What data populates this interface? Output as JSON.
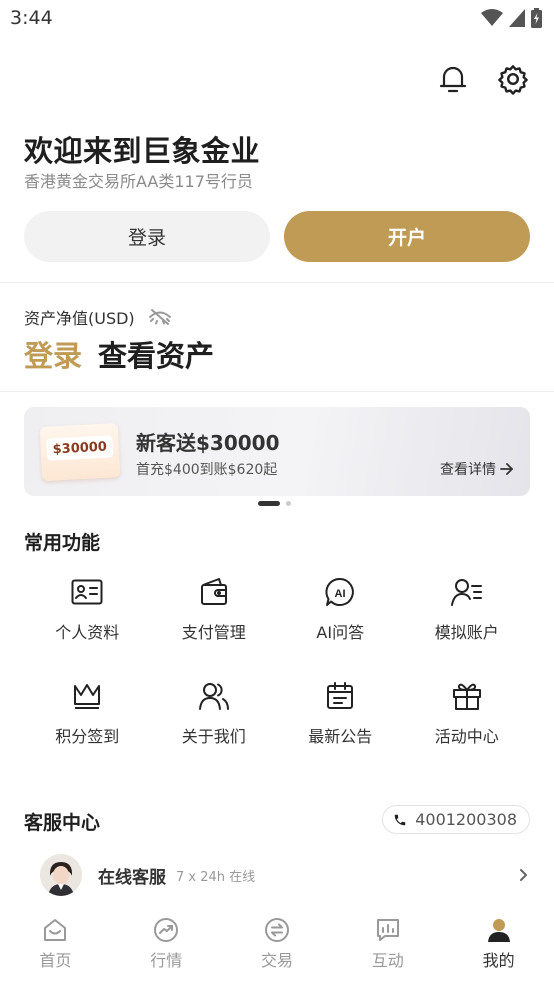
{
  "status_bar": {
    "time": "3:44"
  },
  "header": {
    "title": "欢迎来到巨象金业",
    "subtitle": "香港黄金交易所AA类117号行员",
    "login_button": "登录",
    "open_account_button": "开户"
  },
  "assets": {
    "label": "资产净值(USD)",
    "login_text": "登录",
    "view_text": "查看资产"
  },
  "banner": {
    "ticket_amount": "$30000",
    "title": "新客送$30000",
    "subtitle": "首充$400到账$620起",
    "link": "查看详情"
  },
  "functions": {
    "title": "常用功能",
    "items": [
      {
        "label": "个人资料",
        "icon": "id-card-icon"
      },
      {
        "label": "支付管理",
        "icon": "wallet-icon"
      },
      {
        "label": "AI问答",
        "icon": "ai-chat-icon"
      },
      {
        "label": "模拟账户",
        "icon": "user-list-icon"
      },
      {
        "label": "积分签到",
        "icon": "crown-icon"
      },
      {
        "label": "关于我们",
        "icon": "users-icon"
      },
      {
        "label": "最新公告",
        "icon": "calendar-icon"
      },
      {
        "label": "活动中心",
        "icon": "gift-icon"
      }
    ]
  },
  "service": {
    "title": "客服中心",
    "phone": "4001200308",
    "online_name": "在线客服",
    "online_hours": "7 x 24h 在线"
  },
  "tabs": [
    {
      "label": "首页",
      "icon": "home-icon"
    },
    {
      "label": "行情",
      "icon": "trend-icon"
    },
    {
      "label": "交易",
      "icon": "exchange-icon"
    },
    {
      "label": "互动",
      "icon": "chat-chart-icon"
    },
    {
      "label": "我的",
      "icon": "profile-icon",
      "active": true
    }
  ],
  "colors": {
    "accent": "#bf9b55",
    "text": "#1f1f1f",
    "muted": "#999999"
  }
}
